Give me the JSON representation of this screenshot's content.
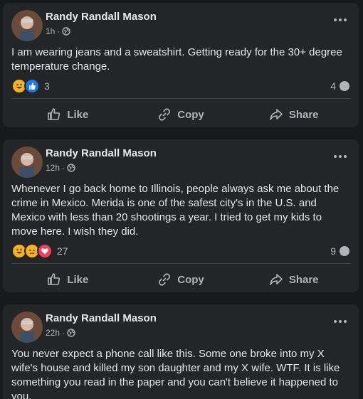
{
  "posts": [
    {
      "author": "Randy Randall Mason",
      "time": "1h",
      "meta_sep": "·",
      "text": "I am wearing jeans and a sweatshirt. Getting ready for the 30+ degree temperature change.",
      "reactions": [
        "haha",
        "like"
      ],
      "reaction_count": "3",
      "comment_count": "4"
    },
    {
      "author": "Randy Randall Mason",
      "time": "12h",
      "meta_sep": "·",
      "text": "Whenever I go back home to Illinois, people always ask me about the crime in Mexico. Merida is one of the safest city's in the U.S. and Mexico with less than 20 shootings a year. I tried to get my kids to move here. I wish they did.",
      "reactions": [
        "haha",
        "sad",
        "love"
      ],
      "reaction_count": "27",
      "comment_count": "9"
    },
    {
      "author": "Randy Randall Mason",
      "time": "22h",
      "meta_sep": "·",
      "text": "You never expect a phone call like this. Some one broke into my X wife's house and killed my son daughter and my X wife. WTF. It is like something you read in the paper and you can't believe it happened to you."
    }
  ],
  "actions": {
    "like": "Like",
    "copy": "Copy",
    "share": "Share"
  },
  "colors": {
    "like": "#1877f2",
    "love": "#f33e58",
    "haha": "#f7b125",
    "background": "#18191a",
    "card": "#242526"
  }
}
